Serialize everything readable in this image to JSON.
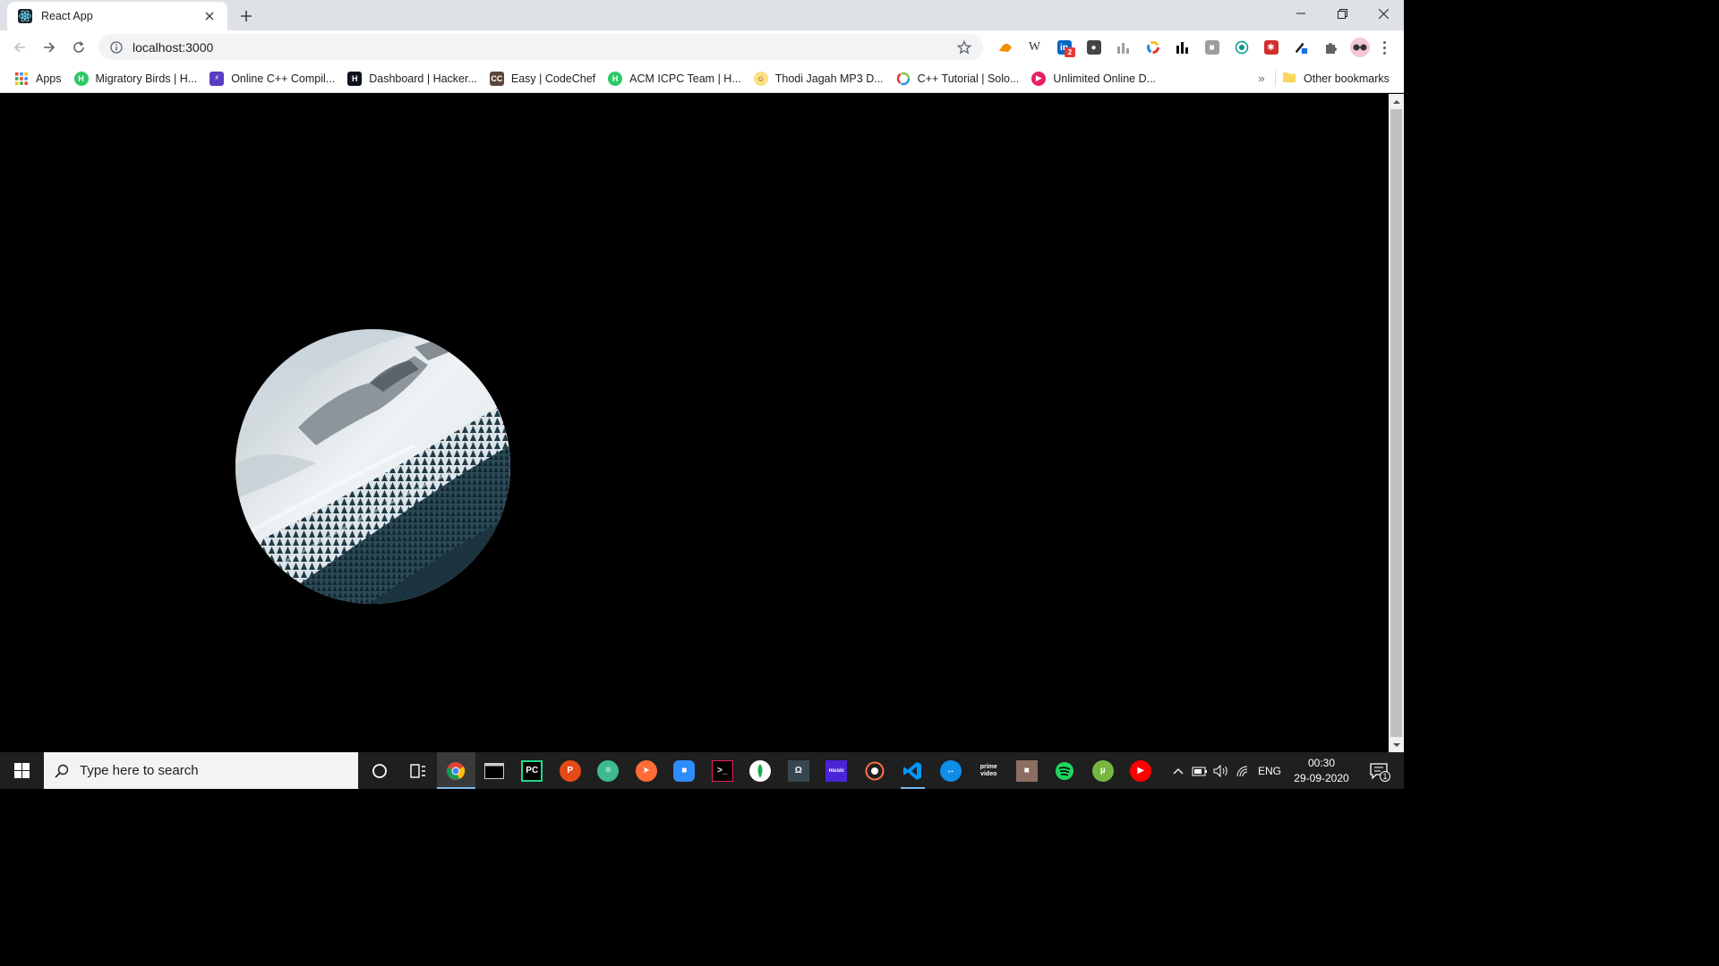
{
  "browser": {
    "tab": {
      "title": "React App",
      "favicon": "react-icon"
    },
    "address": {
      "url": "localhost:3000"
    },
    "bookmarks": [
      {
        "label": "Apps",
        "icon": "apps-grid-icon",
        "color": "#4285f4"
      },
      {
        "label": "Migratory Birds | H...",
        "icon": "hackerrank-icon",
        "color": "#2ec866"
      },
      {
        "label": "Online C++ Compil...",
        "icon": "lightning-icon",
        "color": "#5b3cc4"
      },
      {
        "label": "Dashboard | Hacker...",
        "icon": "hackerrank-dashboard-icon",
        "color": "#0e141e"
      },
      {
        "label": "Easy | CodeChef",
        "icon": "codechef-icon",
        "color": "#5b4638"
      },
      {
        "label": "ACM ICPC Team | H...",
        "icon": "hackerrank-icon",
        "color": "#2ec866"
      },
      {
        "label": "Thodi Jagah MP3 D...",
        "icon": "music-site-icon",
        "color": "#e0b400"
      },
      {
        "label": "C++ Tutorial | Solo...",
        "icon": "sololearn-icon",
        "color": "#1a9ed9"
      },
      {
        "label": "Unlimited Online D...",
        "icon": "download-site-icon",
        "color": "#e91e63"
      }
    ],
    "bookmarks_more": "»",
    "other_bookmarks": "Other bookmarks"
  },
  "taskbar": {
    "search_placeholder": "Type here to search",
    "clock": {
      "time": "00:30",
      "date": "29-09-2020"
    },
    "language": "ENG",
    "notification_count": "1"
  },
  "extensions": {
    "linkedin_badge": "2"
  },
  "colors": {
    "tabstrip": "#dee1e6",
    "page_background": "#000000",
    "taskbar": "#1f1f1f",
    "accent": "#76b9ed"
  }
}
